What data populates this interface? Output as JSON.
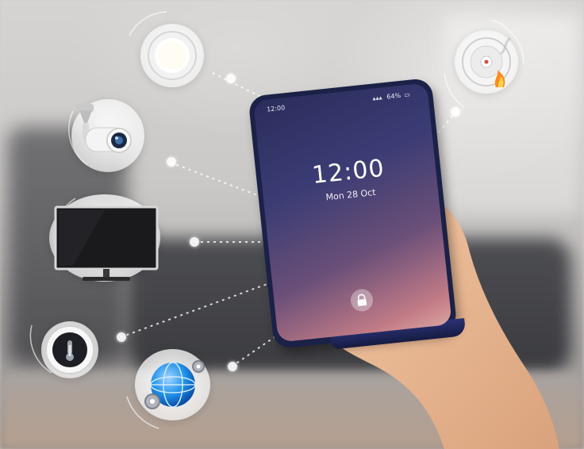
{
  "phone": {
    "time_status": "12:00",
    "battery": "64%",
    "clock": "12:00",
    "date": "Mon 28 Oct"
  },
  "icons": {
    "lamp": "ceiling-light-icon",
    "camera": "security-camera-icon",
    "tv": "television-icon",
    "thermostat": "thermostat-icon",
    "network": "globe-network-icon",
    "smoke": "smoke-detector-icon",
    "lock": "lock-icon"
  },
  "colors": {
    "screen_top": "#2b2d5c",
    "screen_bottom": "#d8a3a0",
    "phone_frame": "#1b2147",
    "globe": "#1e8fe8"
  }
}
